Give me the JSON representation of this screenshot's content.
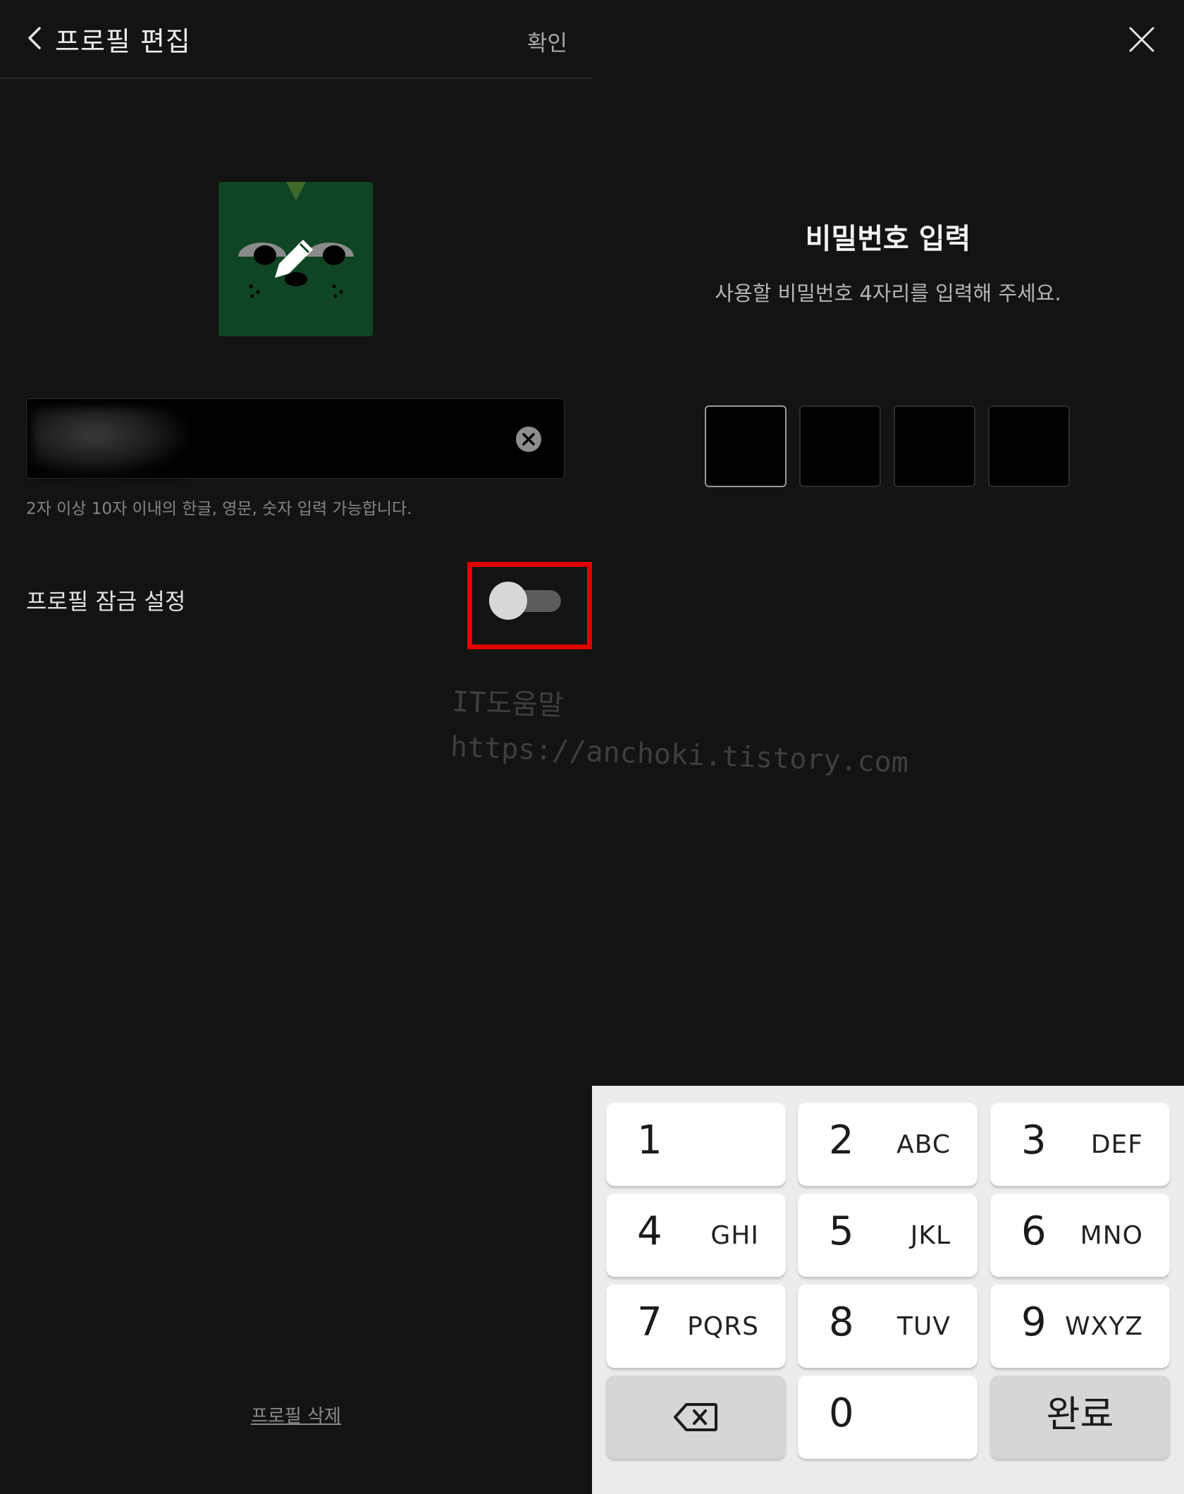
{
  "header": {
    "title": "프로필 편집",
    "confirm_label": "확인"
  },
  "profile": {
    "name_helper": "2자 이상 10자 이내의 한글, 영문, 숫자 입력 가능합니다.",
    "lock_label": "프로필 잠금 설정",
    "lock_enabled": false,
    "delete_label": "프로필 삭제"
  },
  "password": {
    "title": "비밀번호 입력",
    "subtitle": "사용할 비밀번호 4자리를 입력해 주세요.",
    "pin_length": 4
  },
  "keypad": {
    "keys": [
      {
        "num": "1",
        "letters": ""
      },
      {
        "num": "2",
        "letters": "ABC"
      },
      {
        "num": "3",
        "letters": "DEF"
      },
      {
        "num": "4",
        "letters": "GHI"
      },
      {
        "num": "5",
        "letters": "JKL"
      },
      {
        "num": "6",
        "letters": "MNO"
      },
      {
        "num": "7",
        "letters": "PQRS"
      },
      {
        "num": "8",
        "letters": "TUV"
      },
      {
        "num": "9",
        "letters": "WXYZ"
      },
      {
        "num": "0",
        "letters": ""
      }
    ],
    "done_label": "완료"
  },
  "watermark": {
    "line1": "IT도움말",
    "line2": "https://anchoki.tistory.com"
  },
  "colors": {
    "background": "#131313",
    "highlight": "#e00000",
    "avatar_bg": "#0f4424",
    "keypad_bg": "#ececec"
  }
}
